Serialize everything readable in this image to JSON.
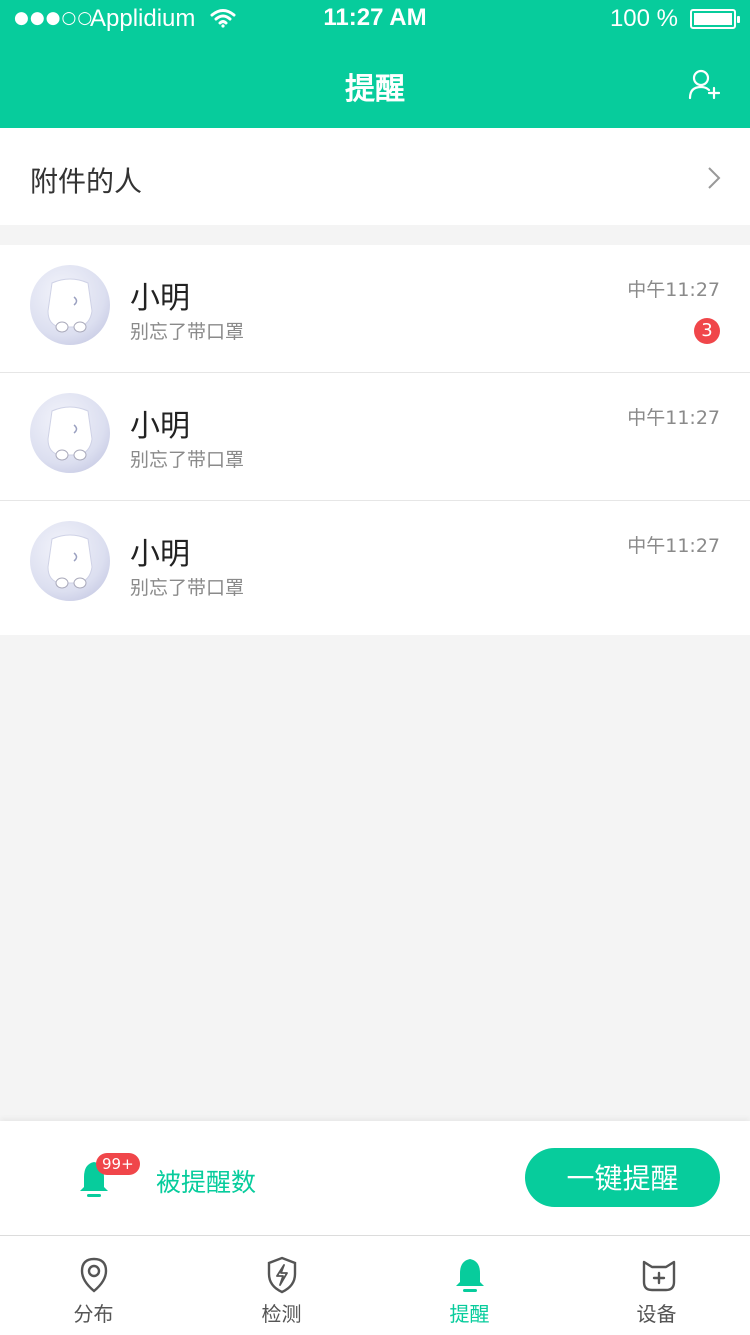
{
  "status_bar": {
    "signal": "●●●○○",
    "carrier": "Applidium",
    "time": "11:27 AM",
    "battery": "100 %"
  },
  "header": {
    "title": "提醒"
  },
  "attach_row": {
    "label": "附件的人"
  },
  "contacts": [
    {
      "name": "小明",
      "message": "别忘了带口罩",
      "time": "中午11:27",
      "unread": "3"
    },
    {
      "name": "小明",
      "message": "别忘了带口罩",
      "time": "中午11:27"
    },
    {
      "name": "小明",
      "message": "别忘了带口罩",
      "time": "中午11:27"
    }
  ],
  "action_bar": {
    "badge": "99+",
    "reminded_label": "被提醒数",
    "remind_all_label": "一键提醒"
  },
  "tabbar": {
    "tabs": [
      {
        "label": "分布",
        "icon": "location-pin-icon"
      },
      {
        "label": "检测",
        "icon": "shield-bolt-icon"
      },
      {
        "label": "提醒",
        "icon": "bell-icon",
        "active": true
      },
      {
        "label": "设备",
        "icon": "device-icon"
      }
    ]
  },
  "colors": {
    "accent": "#07cc9c",
    "badge": "#f0464a",
    "background": "#f4f4f4"
  }
}
